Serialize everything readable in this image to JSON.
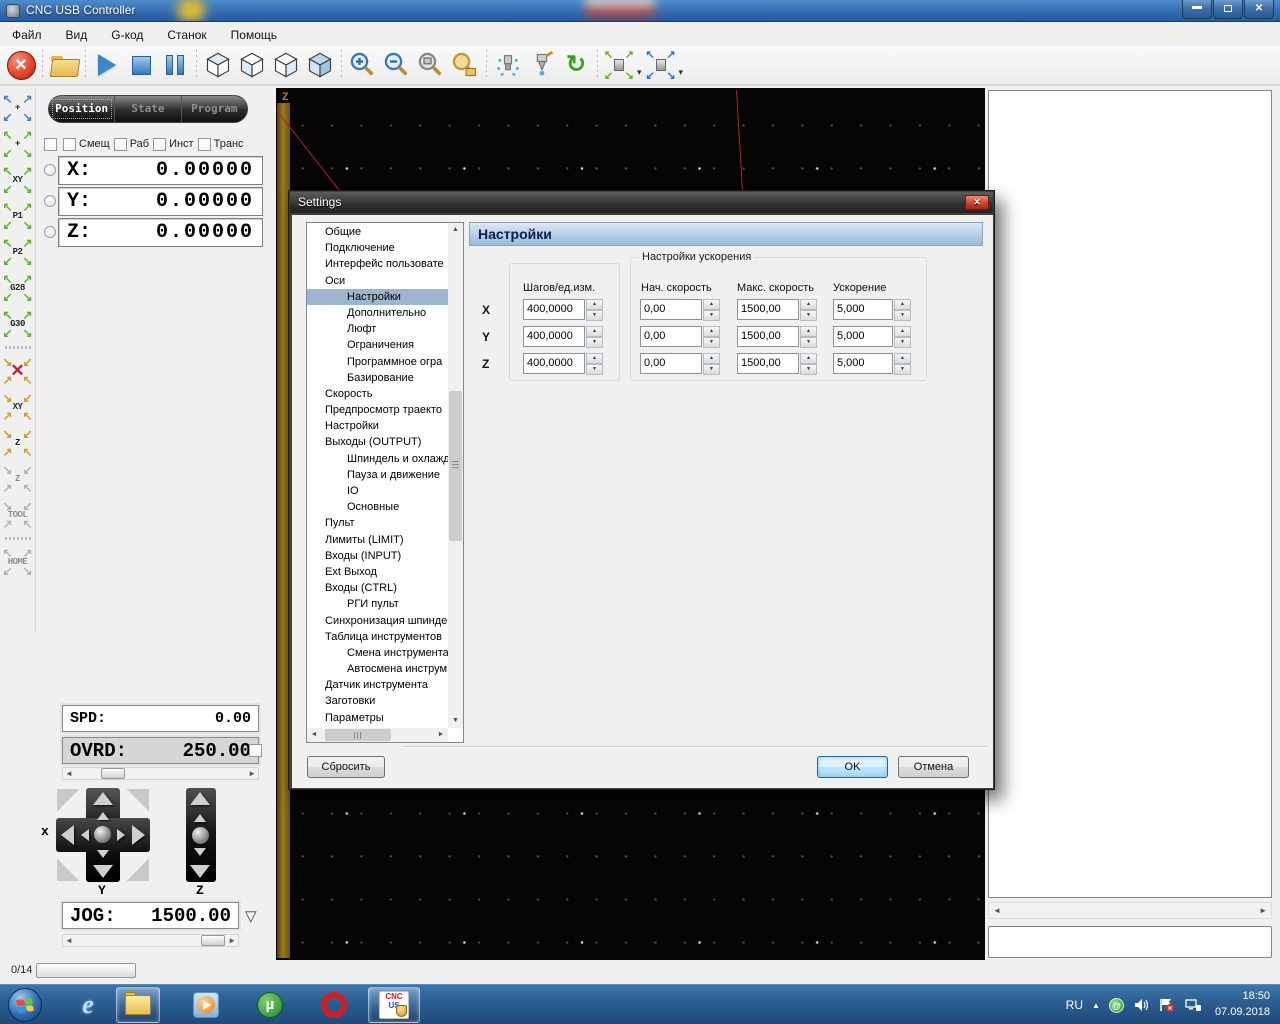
{
  "window": {
    "title": "CNC USB Controller"
  },
  "menu": {
    "items": [
      "Файл",
      "Вид",
      "G-код",
      "Станок",
      "Помощь"
    ]
  },
  "toolbar": {
    "icons": [
      "emergency-stop",
      "open-file",
      "start-program",
      "stop-program",
      "pause-program",
      "view-cube-1",
      "view-cube-2",
      "view-cube-3",
      "view-cube-4",
      "zoom-in",
      "zoom-out",
      "zoom-window",
      "zoom-extents",
      "coolant-spray",
      "tool-probe",
      "return-to-zero",
      "spindle-arrows-green",
      "spindle-arrows-blue"
    ]
  },
  "sidebar": {
    "items": [
      {
        "name": "goto-zero-blue",
        "label": "+",
        "color": "blue",
        "type": "out"
      },
      {
        "name": "set-zero-green",
        "label": "+",
        "color": "green",
        "type": "out"
      },
      {
        "name": "goto-xy",
        "label": "XY",
        "color": "green",
        "type": "out"
      },
      {
        "name": "goto-p1",
        "label": "P1",
        "color": "green",
        "type": "out"
      },
      {
        "name": "goto-p2",
        "label": "P2",
        "color": "green",
        "type": "out"
      },
      {
        "name": "goto-g28",
        "label": "G28",
        "color": "green",
        "type": "out"
      },
      {
        "name": "goto-g30",
        "label": "G30",
        "color": "green",
        "type": "out"
      },
      {
        "sep": true
      },
      {
        "name": "cancel-move",
        "label": "",
        "color": "orange",
        "type": "in",
        "redx": true
      },
      {
        "name": "zero-xy",
        "label": "XY",
        "color": "orange",
        "type": "in"
      },
      {
        "name": "zero-z",
        "label": "Z",
        "color": "orange",
        "type": "in"
      },
      {
        "name": "measure-z",
        "label": "Z",
        "color": "gray",
        "type": "in",
        "disabled": true
      },
      {
        "name": "tool",
        "label": "TOOL",
        "color": "gray",
        "type": "in",
        "disabled": true
      },
      {
        "sep": true
      },
      {
        "name": "home",
        "label": "HOME",
        "color": "gray",
        "type": "out",
        "disabled": true
      }
    ]
  },
  "position_panel": {
    "tabs": [
      "Position",
      "State",
      "Program"
    ],
    "active_tab": "Position",
    "checkbox_labels": [
      "Смещ",
      "Раб",
      "Инст",
      "Транс"
    ],
    "axes": [
      {
        "label": "X:",
        "value": "0.00000"
      },
      {
        "label": "Y:",
        "value": "0.00000"
      },
      {
        "label": "Z:",
        "value": "0.00000"
      }
    ],
    "spd_label": "SPD:",
    "spd_value": "0.00",
    "ovrd_label": "OVRD:",
    "ovrd_value": "250.00",
    "jog_label": "JOG:",
    "jog_value": "1500.00",
    "pad_x_label": "x",
    "pad_y_label": "Y",
    "pad_z_label": "Z"
  },
  "workspace": {
    "z_axis_label": "Z"
  },
  "statusbar": {
    "counter": "0/14"
  },
  "dialog": {
    "title": "Settings",
    "header": "Настройки",
    "accel_group_label": "Настройки ускорения",
    "columns": [
      "Шагов/ед.изм.",
      "Нач. скорость",
      "Макс. скорость",
      "Ускорение"
    ],
    "rows": [
      {
        "axis": "X",
        "steps": "400,0000",
        "start_speed": "0,00",
        "max_speed": "1500,00",
        "accel": "5,000"
      },
      {
        "axis": "Y",
        "steps": "400,0000",
        "start_speed": "0,00",
        "max_speed": "1500,00",
        "accel": "5,000"
      },
      {
        "axis": "Z",
        "steps": "400,0000",
        "start_speed": "0,00",
        "max_speed": "1500,00",
        "accel": "5,000"
      }
    ],
    "reset_label": "Сбросить",
    "ok_label": "OK",
    "cancel_label": "Отмена",
    "tree": [
      {
        "label": "Общие",
        "level": 0
      },
      {
        "label": "Подключение",
        "level": 0
      },
      {
        "label": "Интерфейс пользовате",
        "level": 0
      },
      {
        "label": "Оси",
        "level": 0
      },
      {
        "label": "Настройки",
        "level": 1,
        "selected": true
      },
      {
        "label": "Дополнительно",
        "level": 1
      },
      {
        "label": "Люфт",
        "level": 1
      },
      {
        "label": "Ограничения",
        "level": 1
      },
      {
        "label": "Программное огра",
        "level": 1
      },
      {
        "label": "Базирование",
        "level": 1
      },
      {
        "label": "Скорость",
        "level": 0
      },
      {
        "label": "Предпросмотр траекто",
        "level": 0
      },
      {
        "label": "Настройки",
        "level": 0
      },
      {
        "label": "Выходы (OUTPUT)",
        "level": 0
      },
      {
        "label": "Шпиндель и охлажд",
        "level": 1
      },
      {
        "label": "Пауза и движение",
        "level": 1
      },
      {
        "label": "IO",
        "level": 1
      },
      {
        "label": "Основные",
        "level": 1
      },
      {
        "label": "Пульт",
        "level": 0
      },
      {
        "label": "Лимиты (LIMIT)",
        "level": 0
      },
      {
        "label": "Входы (INPUT)",
        "level": 0
      },
      {
        "label": "Ext Выход",
        "level": 0
      },
      {
        "label": "Входы (CTRL)",
        "level": 0
      },
      {
        "label": "РГИ пульт",
        "level": 1
      },
      {
        "label": "Синхронизация шпинде",
        "level": 0
      },
      {
        "label": "Таблица инструментов",
        "level": 0
      },
      {
        "label": "Смена инструмента",
        "level": 1
      },
      {
        "label": "Автосмена инструм",
        "level": 1
      },
      {
        "label": "Датчик инструмента",
        "level": 0
      },
      {
        "label": "Заготовки",
        "level": 0
      },
      {
        "label": "Параметры",
        "level": 0
      }
    ]
  },
  "taskbar": {
    "apps": [
      "start",
      "internet-explorer",
      "windows-explorer",
      "media-player",
      "utorrent",
      "opera",
      "cnc-usb-controller"
    ],
    "lang": "RU",
    "time": "18:50",
    "date": "07.09.2018"
  },
  "colors": {
    "accent_blue": "#2e6ab8",
    "estop_red": "#c01810",
    "selection": "#9cb6ce",
    "workspace_bg": "#050505",
    "z_bar": "#9a7a1e",
    "red_line": "#b62121"
  }
}
